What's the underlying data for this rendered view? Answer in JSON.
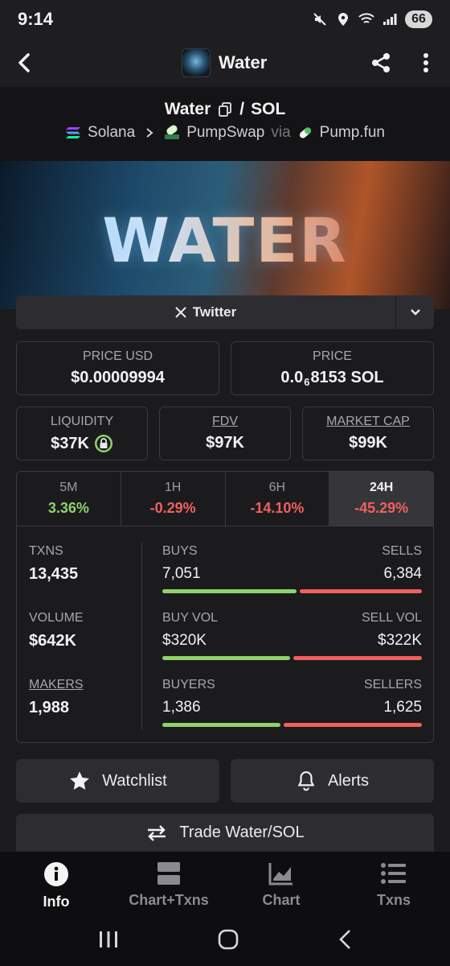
{
  "status_bar": {
    "time": "9:14",
    "battery": "66"
  },
  "app_bar": {
    "title": "Water"
  },
  "pair": {
    "base": "Water",
    "separator": "/",
    "quote": "SOL",
    "chain": "Solana",
    "dex": "PumpSwap",
    "via_label": "via",
    "launchpad": "Pump.fun"
  },
  "banner": {
    "word": "WATER"
  },
  "social": {
    "twitter_label": "Twitter"
  },
  "price": {
    "usd_label": "PRICE USD",
    "usd_value": "$0.00009994",
    "native_label": "PRICE",
    "native_prefix": "0.0",
    "native_zeros": "6",
    "native_suffix": "8153 SOL"
  },
  "metrics": {
    "liquidity_label": "LIQUIDITY",
    "liquidity_value": "$37K",
    "fdv_label": "FDV",
    "fdv_value": "$97K",
    "mcap_label": "MARKET CAP",
    "mcap_value": "$99K"
  },
  "timeframes": [
    {
      "label": "5M",
      "value": "3.36%"
    },
    {
      "label": "1H",
      "value": "-0.29%"
    },
    {
      "label": "6H",
      "value": "-14.10%"
    },
    {
      "label": "24H",
      "value": "-45.29%"
    }
  ],
  "stats": {
    "txns_label": "TXNS",
    "txns_value": "13,435",
    "volume_label": "VOLUME",
    "volume_value": "$642K",
    "makers_label": "MAKERS",
    "makers_value": "1,988",
    "buys_label": "BUYS",
    "buys_value": "7,051",
    "sells_label": "SELLS",
    "sells_value": "6,384",
    "buys_ratio": 0.525,
    "buyvol_label": "BUY VOL",
    "buyvol_value": "$320K",
    "sellvol_label": "SELL VOL",
    "sellvol_value": "$322K",
    "buyvol_ratio": 0.498,
    "buyers_label": "BUYERS",
    "buyers_value": "1,386",
    "sellers_label": "SELLERS",
    "sellers_value": "1,625",
    "buyers_ratio": 0.46
  },
  "actions": {
    "watchlist_label": "Watchlist",
    "alerts_label": "Alerts",
    "trade_label": "Trade Water/SOL"
  },
  "bottom_nav": [
    {
      "label": "Info",
      "icon": "info-icon"
    },
    {
      "label": "Chart+Txns",
      "icon": "chart-txns-icon"
    },
    {
      "label": "Chart",
      "icon": "chart-icon"
    },
    {
      "label": "Txns",
      "icon": "list-icon"
    }
  ],
  "colors": {
    "positive": "#8ed26a",
    "negative": "#f0605e",
    "background": "#1b1b1e"
  }
}
